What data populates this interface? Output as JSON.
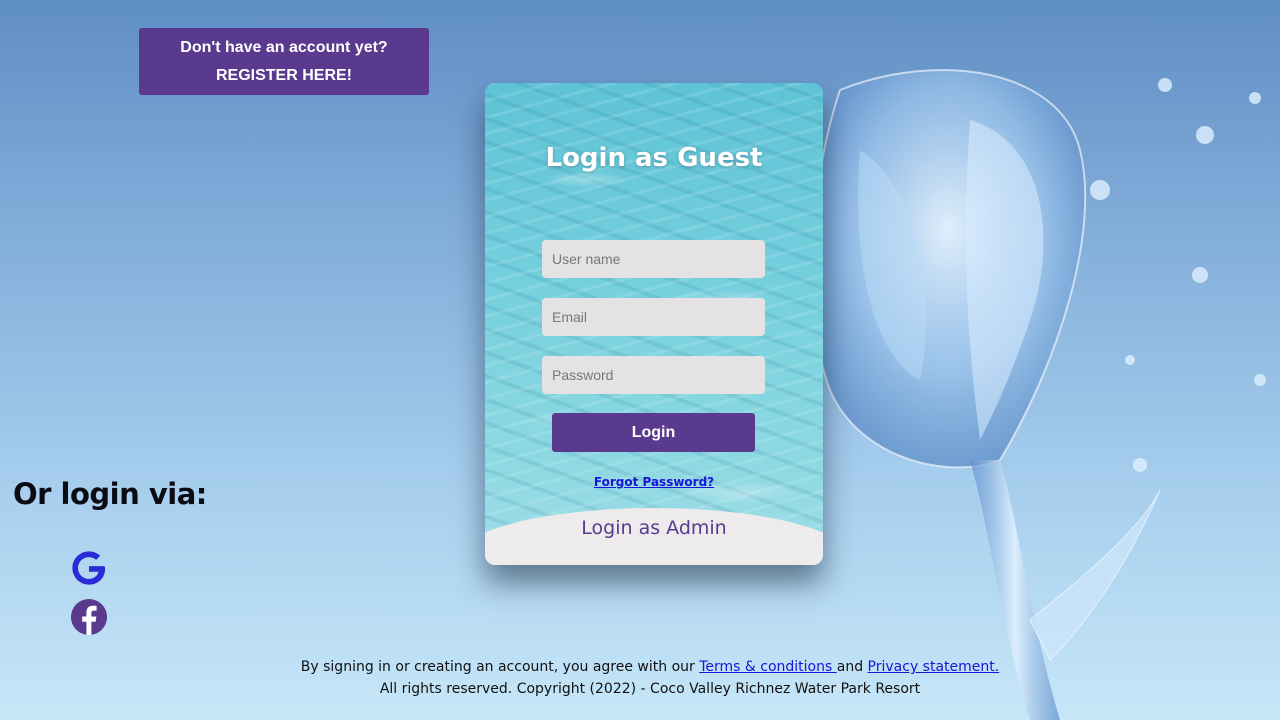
{
  "register": {
    "line1": "Don't have an account yet?",
    "line2": "REGISTER HERE!"
  },
  "login_card": {
    "title": "Login as Guest",
    "username_placeholder": "User name",
    "email_placeholder": "Email",
    "password_placeholder": "Password",
    "login_label": "Login",
    "forgot_label": "Forgot Password?",
    "admin_label": "Login as Admin"
  },
  "social": {
    "heading": "Or login via:",
    "providers": [
      {
        "name": "google",
        "icon": "google-icon",
        "color": "#2b2bd6"
      },
      {
        "name": "facebook",
        "icon": "facebook-icon",
        "color": "#5a3a8e"
      }
    ]
  },
  "footer": {
    "prefix": "By signing in or creating an account, you agree with our ",
    "terms_label": "Terms & conditions ",
    "conjunction": "and ",
    "privacy_label": "Privacy statement.",
    "copyright": "All rights reserved. Copyright (2022) - Coco Valley Richnez Water Park Resort"
  },
  "colors": {
    "accent_purple": "#5a3a8e",
    "link_blue": "#1a14d6",
    "field_bg": "#e4e2e3"
  }
}
